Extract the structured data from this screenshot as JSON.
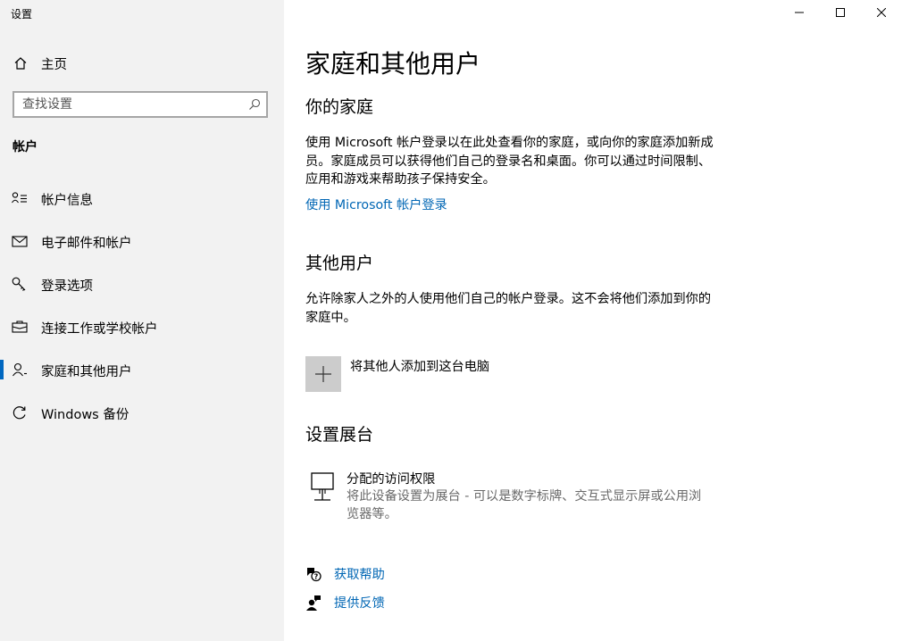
{
  "window": {
    "title": "设置",
    "controls": [
      "minimize-icon",
      "maximize-icon",
      "close-icon"
    ]
  },
  "sidebar": {
    "home_label": "主页",
    "search_placeholder": "查找设置",
    "section_heading": "帐户",
    "items": [
      {
        "label": "帐户信息",
        "icon": "account-info-icon"
      },
      {
        "label": "电子邮件和帐户",
        "icon": "mail-icon"
      },
      {
        "label": "登录选项",
        "icon": "key-icon"
      },
      {
        "label": "连接工作或学校帐户",
        "icon": "briefcase-icon"
      },
      {
        "label": "家庭和其他用户",
        "icon": "person-icon",
        "active": true
      },
      {
        "label": "Windows 备份",
        "icon": "sync-icon"
      }
    ]
  },
  "main": {
    "title": "家庭和其他用户",
    "family": {
      "heading": "你的家庭",
      "description": "使用 Microsoft 帐户登录以在此处查看你的家庭，或向你的家庭添加新成员。家庭成员可以获得他们自己的登录名和桌面。你可以通过时间限制、应用和游戏来帮助孩子保持安全。",
      "link": "使用 Microsoft 帐户登录"
    },
    "other_users": {
      "heading": "其他用户",
      "description": "允许除家人之外的人使用他们自己的帐户登录。这不会将他们添加到你的家庭中。",
      "add_label": "将其他人添加到这台电脑"
    },
    "kiosk": {
      "heading": "设置展台",
      "title": "分配的访问权限",
      "description": "将此设备设置为展台 - 可以是数字标牌、交互式显示屏或公用浏览器等。"
    },
    "help": {
      "get_help": "获取帮助",
      "feedback": "提供反馈"
    }
  },
  "colors": {
    "sidebar_bg": "#f2f2f2",
    "accent": "#0067c0",
    "link": "#0066b4",
    "plus_tile": "#cccccc"
  }
}
